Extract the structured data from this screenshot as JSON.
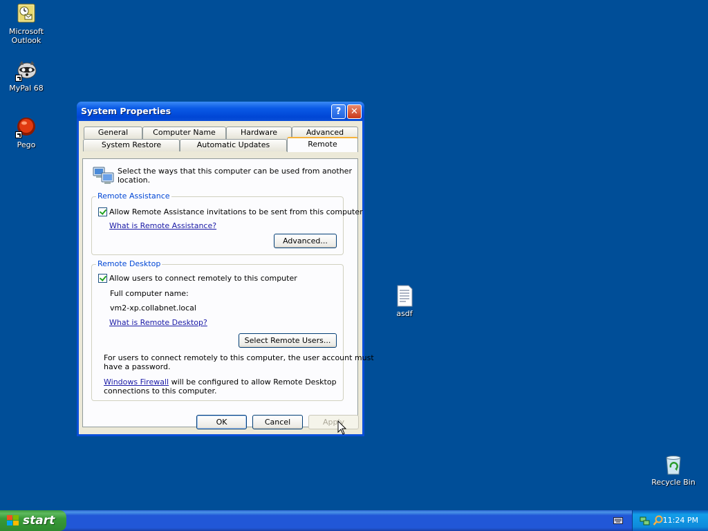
{
  "desktop": {
    "icons": [
      {
        "label_line1": "Microsoft",
        "label_line2": "Outlook",
        "icon": "outlook-icon"
      },
      {
        "label": "MyPal 68",
        "icon": "mypal-icon"
      },
      {
        "label": "Pego",
        "icon": "pego-icon"
      },
      {
        "label": "asdf",
        "icon": "text-document-icon"
      },
      {
        "label": "Recycle Bin",
        "icon": "recycle-bin-icon"
      }
    ]
  },
  "window": {
    "title": "System Properties",
    "help_glyph": "?",
    "close_glyph": "✕",
    "tabs_row1": [
      "General",
      "Computer Name",
      "Hardware",
      "Advanced"
    ],
    "tabs_row2": [
      "System Restore",
      "Automatic Updates",
      "Remote"
    ],
    "active_tab": "Remote",
    "intro_line1": "Select the ways that this computer can be used from another",
    "intro_line2": "location.",
    "remote_assistance": {
      "legend": "Remote Assistance",
      "checkbox_label": "Allow Remote Assistance invitations to be sent from this computer",
      "checked": true,
      "link": "What is Remote Assistance?",
      "advanced_button": "Advanced..."
    },
    "remote_desktop": {
      "legend": "Remote Desktop",
      "checkbox_label": "Allow users to connect remotely to this computer",
      "checked": true,
      "full_name_label": "Full computer name:",
      "full_name_value": "vm2-xp.collabnet.local",
      "link": "What is Remote Desktop?",
      "select_users_button": "Select Remote Users...",
      "note_line1": "For users to connect remotely to this computer, the user account must",
      "note_line2": "have a password.",
      "firewall_link": "Windows Firewall",
      "firewall_text_line1": " will be configured to allow Remote Desktop",
      "firewall_text_line2": "connections to this computer."
    },
    "buttons": {
      "ok": "OK",
      "cancel": "Cancel",
      "apply": "Apply"
    }
  },
  "taskbar": {
    "start_label": "start",
    "clock": "11:24 PM"
  },
  "colors": {
    "desktop": "#004e98",
    "title_bar": "#0a5ae6",
    "start_green": "#389a38",
    "tab_highlight": "#f6b33a"
  }
}
